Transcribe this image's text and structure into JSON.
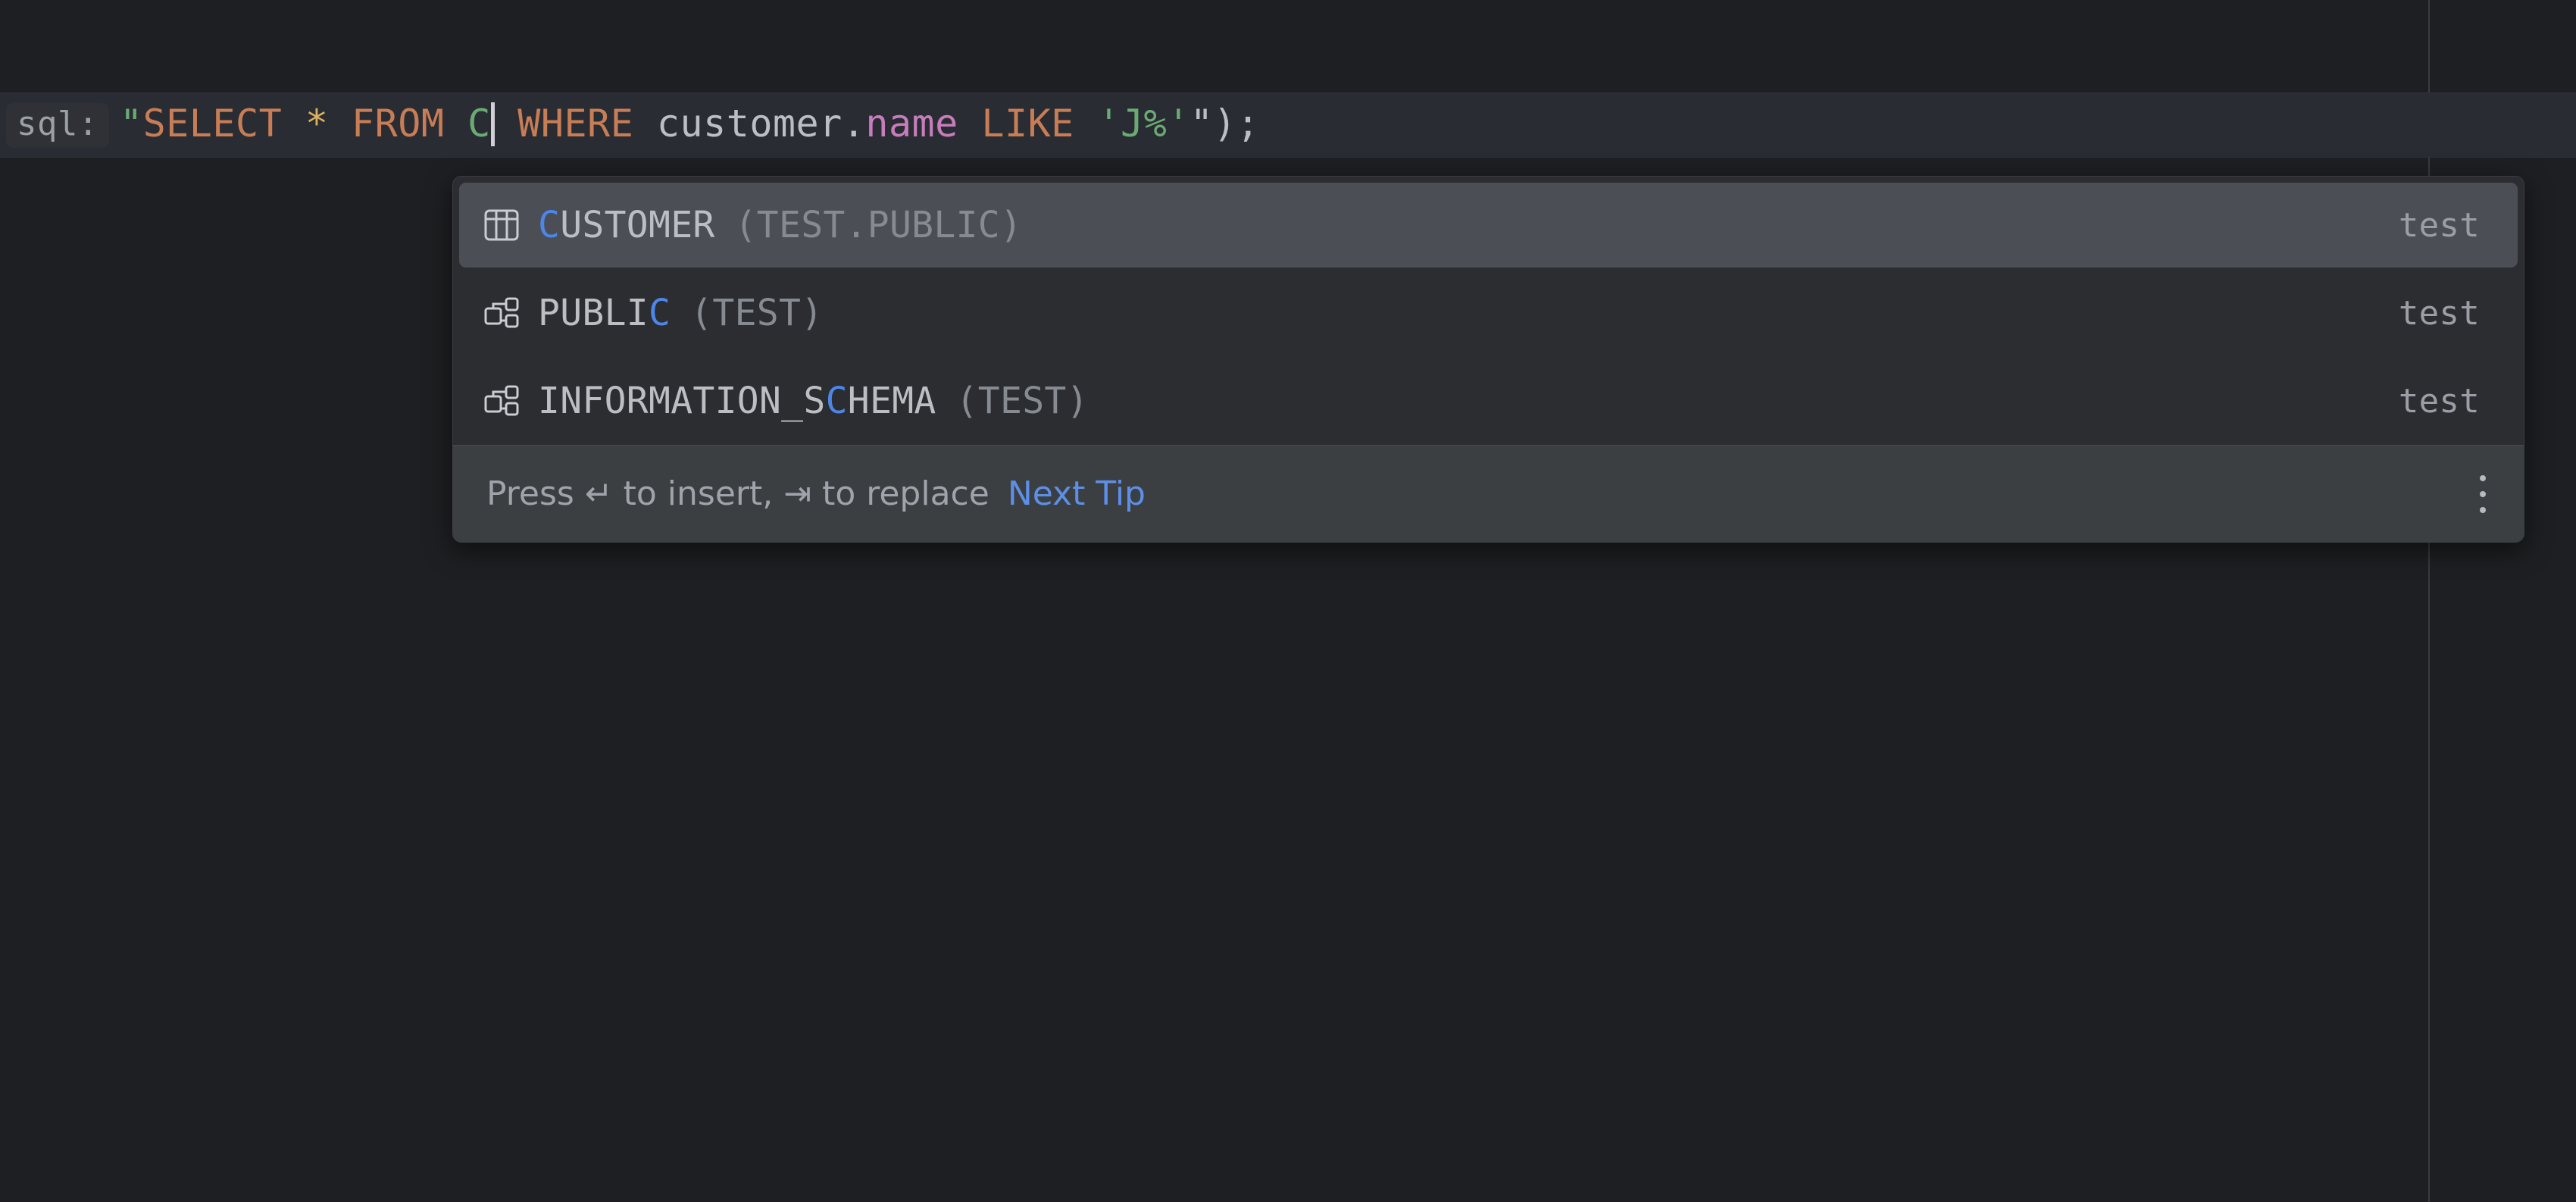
{
  "editor": {
    "language_chip": "sql:",
    "code_tokens": [
      {
        "text": "\"",
        "kind": "string"
      },
      {
        "text": "SELECT",
        "kind": "keyword"
      },
      {
        "text": " ",
        "kind": "plain"
      },
      {
        "text": "*",
        "kind": "star"
      },
      {
        "text": " ",
        "kind": "plain"
      },
      {
        "text": "FROM",
        "kind": "keyword"
      },
      {
        "text": " ",
        "kind": "plain"
      },
      {
        "text": "C",
        "kind": "green"
      },
      {
        "text": "CARET",
        "kind": "caret"
      },
      {
        "text": " ",
        "kind": "plain"
      },
      {
        "text": "WHERE",
        "kind": "keyword"
      },
      {
        "text": " ",
        "kind": "plain"
      },
      {
        "text": "customer",
        "kind": "ident"
      },
      {
        "text": ".",
        "kind": "ident"
      },
      {
        "text": "name",
        "kind": "field"
      },
      {
        "text": " ",
        "kind": "plain"
      },
      {
        "text": "LIKE",
        "kind": "keyword"
      },
      {
        "text": " ",
        "kind": "plain"
      },
      {
        "text": "'J%'",
        "kind": "string"
      },
      {
        "text": "\"",
        "kind": "plain"
      },
      {
        "text": ");",
        "kind": "plain"
      }
    ],
    "code_plain_text": "sql: \"SELECT * FROM C WHERE customer.name LIKE 'J%'\");",
    "caret_after": "C"
  },
  "completion_popup": {
    "items": [
      {
        "icon": "table-icon",
        "label_prefix": "",
        "label_match": "C",
        "label_suffix": "USTOMER",
        "qualifier": "(TEST.PUBLIC)",
        "data_source": "test",
        "selected": true
      },
      {
        "icon": "schema-icon",
        "label_prefix": "PUBLI",
        "label_match": "C",
        "label_suffix": "",
        "qualifier": "(TEST)",
        "data_source": "test",
        "selected": false
      },
      {
        "icon": "schema-icon",
        "label_prefix": "INFORMATION_S",
        "label_match": "C",
        "label_suffix": "HEMA",
        "qualifier": "(TEST)",
        "data_source": "test",
        "selected": false
      }
    ],
    "footer": {
      "hint": "Press ↵ to insert, ⇥ to replace",
      "link": "Next Tip",
      "menu_icon": "kebab-menu-icon"
    }
  },
  "colors": {
    "editor_background": "#1e1f22",
    "caret_row_background": "#2a2c33",
    "popup_background": "#2b2d30",
    "selected_row_background": "#4b4e55",
    "footer_background": "#3c3f41",
    "match_highlight": "#4d86e8",
    "link": "#5d8fe8",
    "keyword": "#c77d55",
    "string": "#6aab73",
    "field": "#c77dbb",
    "identifier": "#bcbec4",
    "star": "#d9b160"
  }
}
